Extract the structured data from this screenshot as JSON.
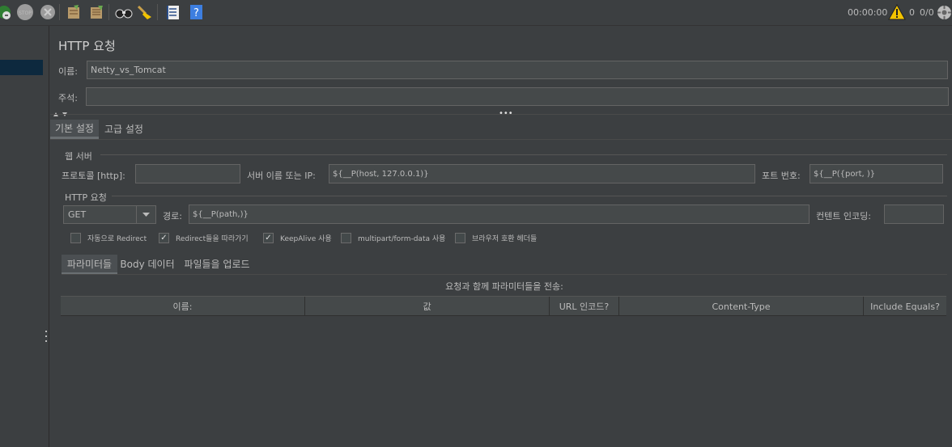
{
  "toolbar": {
    "icons": [
      "start-no-pause-icon",
      "stop-icon",
      "shutdown-icon",
      "clear-icon",
      "clear-all-icon",
      "search-icon",
      "reset-search-icon",
      "function-helper-icon",
      "help-icon"
    ],
    "elapsed_time": "00:00:00",
    "warning_count": "0",
    "thread_count": "0/0"
  },
  "panel": {
    "title": "HTTP 요청",
    "name_label": "이름:",
    "name_value": "Netty_vs_Tomcat",
    "comment_label": "주석:",
    "comment_value": ""
  },
  "tabs": {
    "basic": "기본 설정",
    "advanced": "고급 설정"
  },
  "web_server": {
    "section_label": "웹 서버",
    "protocol_label": "프로토콜 [http]:",
    "protocol_value": "",
    "server_label": "서버 이름 또는 IP:",
    "server_value": "${__P(host, 127.0.0.1)}",
    "port_label": "포트 번호:",
    "port_value": "${__P({port, )}"
  },
  "http_request": {
    "section_label": "HTTP 요청",
    "method": "GET",
    "path_label": "경로:",
    "path_value": "${__P(path,)}",
    "encoding_label": "컨텐트 인코딩:",
    "encoding_value": ""
  },
  "options": [
    {
      "label": "자동으로 Redirect",
      "checked": false
    },
    {
      "label": "Redirect들을 따라가기",
      "checked": true
    },
    {
      "label": "KeepAlive 사용",
      "checked": true
    },
    {
      "label": "multipart/form-data 사용",
      "checked": false
    },
    {
      "label": "브라우저 호환 헤더들",
      "checked": false
    }
  ],
  "sub_tabs": {
    "parameters": "파라미터들",
    "body": "Body 데이터",
    "files": "파일들을 업로드"
  },
  "params_table": {
    "caption": "요청과 함께 파라미터들을 전송:",
    "columns": [
      "이름:",
      "값",
      "URL 인코드?",
      "Content-Type",
      "Include Equals?"
    ]
  },
  "colors": {
    "background": "#3c3f41",
    "field": "#45494a",
    "selection": "#0d293e",
    "warning": "#f2c300",
    "help": "#3d7ee0"
  }
}
